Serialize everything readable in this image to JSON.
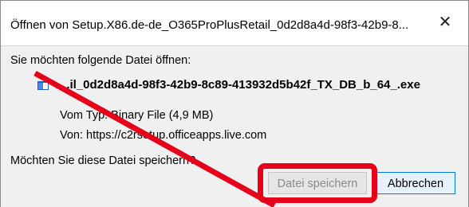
{
  "window": {
    "title": "Öffnen von Setup.X86.de-de_O365ProPlusRetail_0d2d8a4d-98f3-42b9-8...",
    "close_symbol": "✕"
  },
  "dialog": {
    "prompt": "Sie möchten folgende Datei öffnen:",
    "file_name": "...il_0d2d8a4d-98f3-42b9-8c89-413932d5b42f_TX_DB_b_64_.exe",
    "type_line": "Vom Typ: Binary File (4,9 MB)",
    "source_line": "Von: https://c2rsetup.officeapps.live.com",
    "question": "Möchten Sie diese Datei speichern?",
    "file_icon": "file-icon"
  },
  "buttons": {
    "save_label": "Datei speichern",
    "cancel_label": "Abbrechen"
  },
  "annotations": {
    "highlight_color": "#e6001a",
    "arrow_color": "#e6001a"
  }
}
